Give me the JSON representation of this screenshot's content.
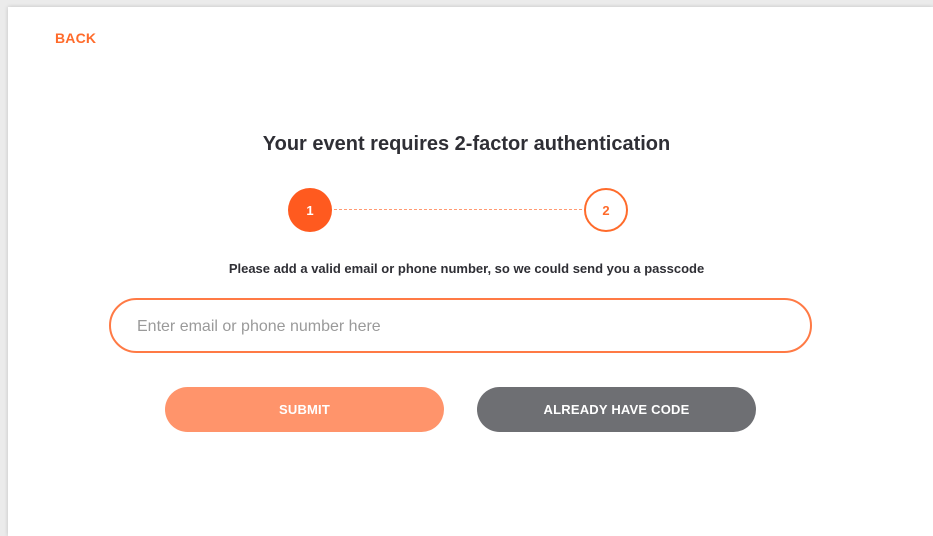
{
  "header": {
    "back_label": "BACK"
  },
  "main": {
    "title": "Your event requires 2-factor authentication",
    "steps": [
      {
        "label": "1",
        "state": "active"
      },
      {
        "label": "2",
        "state": "inactive"
      }
    ],
    "instructions": "Please add a valid email or phone number, so we could send you a passcode",
    "contact_input": {
      "value": "",
      "placeholder": "Enter email or phone number here"
    },
    "submit_label": "SUBMIT",
    "already_have_code_label": "ALREADY HAVE CODE"
  },
  "colors": {
    "accent": "#ff5a1f",
    "accent_light": "#ff946b",
    "secondary_button": "#6e6f73",
    "text_dark": "#2f2f35"
  }
}
